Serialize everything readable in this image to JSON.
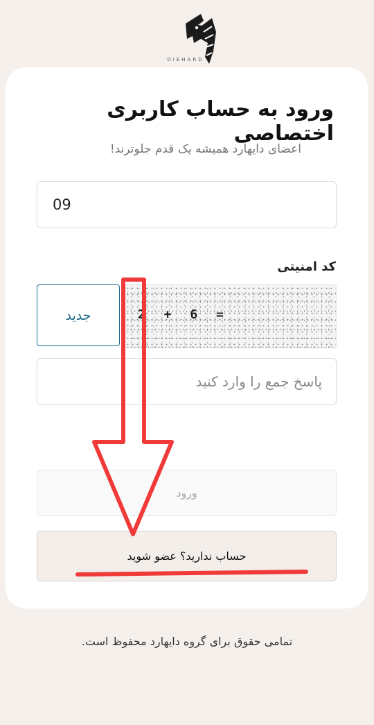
{
  "logo": {
    "icon": "eagle-logo-icon",
    "text": "DIEHARD"
  },
  "login_form": {
    "title": "ورود به حساب کاربری اختصاصی",
    "subtitle": "اعضای دایهارد همیشه یک قدم جلوترند!",
    "phone_value": "09",
    "captcha_label": "کد امنیتی",
    "captcha_refresh_label": "جدید",
    "captcha_expression": "2 + 6 =",
    "answer_placeholder": "پاسخ جمع را وارد کنید",
    "login_label": "ورود",
    "register_label": "حساب ندارید؟ عضو شوید"
  },
  "footer": {
    "copyright": "تمامی حقوق برای گروه دایهارد محفوظ است."
  },
  "colors": {
    "background": "#f5f0eb",
    "card": "#ffffff",
    "accent": "#1a6a8a",
    "annotation_red": "#f03a3a"
  }
}
